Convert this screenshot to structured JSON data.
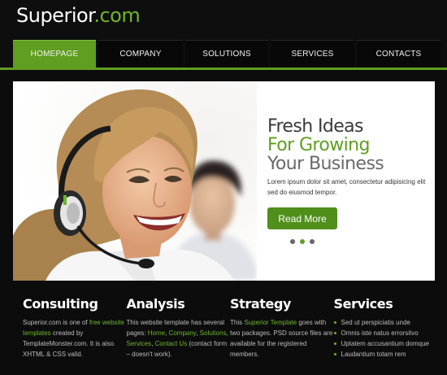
{
  "logo": {
    "name": "Superior",
    "suffix": ".com"
  },
  "nav": {
    "items": [
      {
        "label": "HOMEPAGE",
        "active": true
      },
      {
        "label": "COMPANY"
      },
      {
        "label": "SOLUTIONS"
      },
      {
        "label": "SERVICES"
      },
      {
        "label": "CONTACTS"
      }
    ]
  },
  "hero": {
    "line1": "Fresh Ideas",
    "line2": "For Growing",
    "line3": "Your Business",
    "text": "Lorem ipsum dolor sit amet, consectetur adipisicing elit sed do eiusmod tempor.",
    "button": "Read More",
    "slides": 3,
    "active_slide": 2
  },
  "columns": {
    "consulting": {
      "title": "Consulting",
      "t1": "Superior.com is one of ",
      "link1": "free website templates",
      "t2": " created by TemplateMonster.com. It is also XHTML & CSS valid."
    },
    "analysis": {
      "title": "Analysis",
      "t1": "This website template has several pages: ",
      "l_home": "Home",
      "sep1": ", ",
      "l_company": "Company",
      "sep2": ", ",
      "l_solutions": "Solutions",
      "sep3": ", ",
      "l_services": "Services",
      "sep4": ", ",
      "l_contact": "Contact Us",
      "t2": " (contact form – doesn't work)."
    },
    "strategy": {
      "title": "Strategy",
      "t1": "This ",
      "link1": "Superior Template",
      "t2": " goes with two packages. PSD source files are available for the registered members."
    },
    "services": {
      "title": "Services",
      "items": [
        "Sed ut perspiciatis unde",
        "Omnis iste natus errorsitvo",
        "Uptatem accusantium domque",
        "Laudantium totam rem"
      ]
    }
  },
  "colors": {
    "accent": "#5f9e20",
    "background": "#0c0c0c"
  }
}
